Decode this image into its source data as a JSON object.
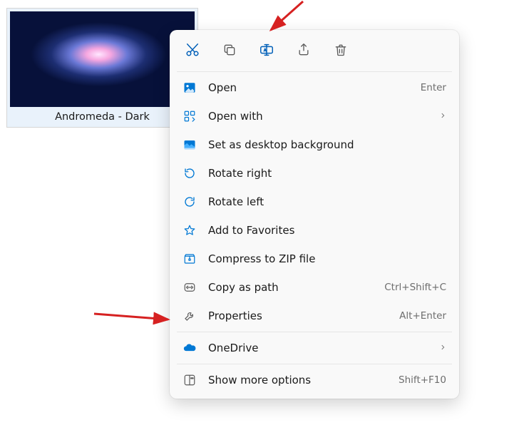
{
  "file": {
    "name": "Andromeda - Dark"
  },
  "toolbar": {
    "cut": "Cut",
    "copy": "Copy",
    "rename": "Rename",
    "share": "Share",
    "delete": "Delete"
  },
  "menu": {
    "open": {
      "label": "Open",
      "shortcut": "Enter"
    },
    "open_with": {
      "label": "Open with"
    },
    "set_background": {
      "label": "Set as desktop background"
    },
    "rotate_right": {
      "label": "Rotate right"
    },
    "rotate_left": {
      "label": "Rotate left"
    },
    "add_favorites": {
      "label": "Add to Favorites"
    },
    "compress_zip": {
      "label": "Compress to ZIP file"
    },
    "copy_as_path": {
      "label": "Copy as path",
      "shortcut": "Ctrl+Shift+C"
    },
    "properties": {
      "label": "Properties",
      "shortcut": "Alt+Enter"
    },
    "onedrive": {
      "label": "OneDrive"
    },
    "show_more": {
      "label": "Show more options",
      "shortcut": "Shift+F10"
    }
  },
  "colors": {
    "accent": "#005fb8",
    "onedrive": "#0078d4"
  }
}
